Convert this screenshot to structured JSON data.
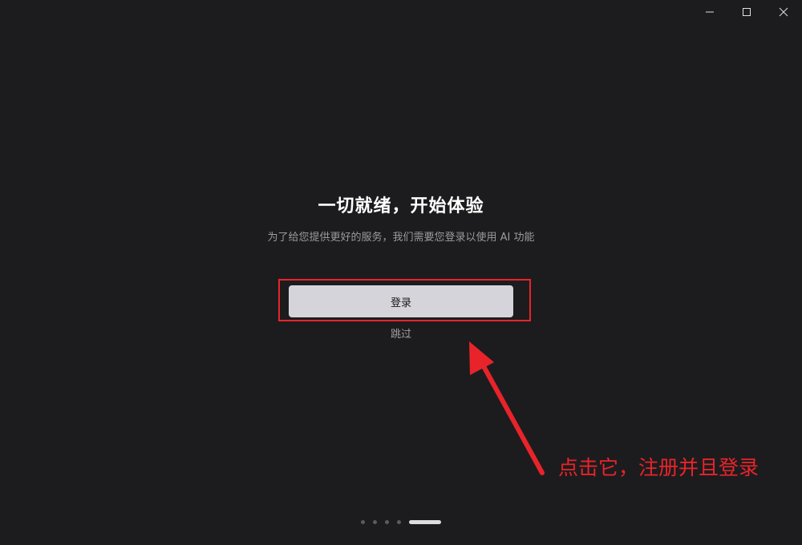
{
  "window": {
    "controls": {
      "minimize_icon": "minimize-icon",
      "maximize_icon": "maximize-icon",
      "close_icon": "close-icon"
    }
  },
  "main": {
    "title": "一切就绪，开始体验",
    "subtitle": "为了给您提供更好的服务，我们需要您登录以使用 AI 功能",
    "login_label": "登录",
    "skip_label": "跳过"
  },
  "annotation": {
    "text": "点击它，注册并且登录",
    "color": "#e8242a"
  },
  "pager": {
    "total": 5,
    "current": 5
  },
  "colors": {
    "background": "#1c1c1e",
    "button": "#d4d4da",
    "accent": "#e8242a"
  }
}
